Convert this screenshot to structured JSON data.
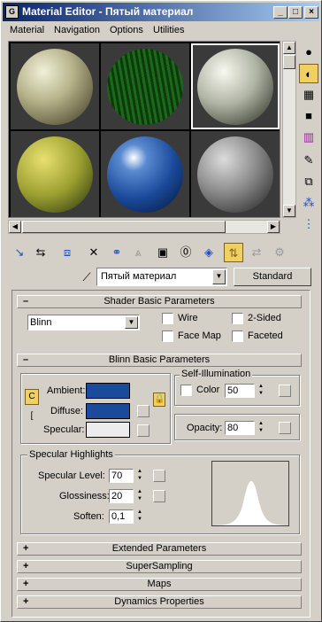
{
  "window": {
    "title": "Material Editor - Пятый материал",
    "app_icon": "3ds-icon",
    "min_label": "_",
    "max_label": "□",
    "close_label": "×"
  },
  "menu": {
    "items": [
      "Material",
      "Navigation",
      "Options",
      "Utilities"
    ]
  },
  "material": {
    "name": "Пятый материал",
    "type_button": "Standard"
  },
  "shader_basic": {
    "header": "Shader Basic Parameters",
    "sign": "–",
    "shader": "Blinn",
    "wire_label": "Wire",
    "two_sided_label": "2-Sided",
    "face_map_label": "Face Map",
    "faceted_label": "Faceted",
    "wire": false,
    "two_sided": false,
    "face_map": false,
    "faceted": false
  },
  "blinn_basic": {
    "header": "Blinn Basic Parameters",
    "sign": "–",
    "ambient_label": "Ambient:",
    "diffuse_label": "Diffuse:",
    "specular_label": "Specular:",
    "ambient_color": "#1a4a9a",
    "diffuse_color": "#1a4a9a",
    "specular_color": "#ececec",
    "self_illum_title": "Self-Illumination",
    "color_label": "Color",
    "color_checked": false,
    "self_illum_value": "50",
    "opacity_label": "Opacity:",
    "opacity_value": "80"
  },
  "specular_highlights": {
    "title": "Specular Highlights",
    "level_label": "Specular Level:",
    "level_value": "70",
    "gloss_label": "Glossiness:",
    "gloss_value": "20",
    "soften_label": "Soften:",
    "soften_value": "0,1"
  },
  "rollouts": [
    {
      "sign": "+",
      "label": "Extended Parameters"
    },
    {
      "sign": "+",
      "label": "SuperSampling"
    },
    {
      "sign": "+",
      "label": "Maps"
    },
    {
      "sign": "+",
      "label": "Dynamics Properties"
    }
  ],
  "icons": {
    "sidebar": [
      "sample-type-sphere-icon",
      "backlight-icon",
      "background-checker-icon",
      "sample-uv-tiling-icon",
      "video-color-check-icon",
      "make-preview-icon",
      "options-icon",
      "select-by-material-icon",
      "material-map-navigator-icon"
    ],
    "toolbar": [
      "get-material-icon",
      "put-to-scene-icon",
      "assign-to-selection-icon",
      "reset-map-icon",
      "make-unique-icon",
      "put-to-library-icon",
      "material-effects-channel-icon",
      "show-map-in-viewport-icon",
      "show-end-result-icon",
      "go-to-parent-icon",
      "go-forward-to-sibling-icon"
    ],
    "eyedropper": "pick-material-from-object-icon"
  }
}
